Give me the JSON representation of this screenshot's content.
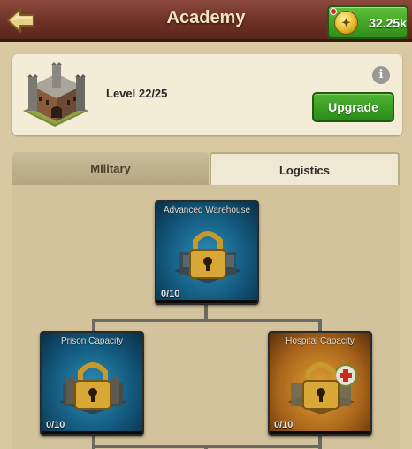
{
  "header": {
    "title": "Academy",
    "gold_amount": "32.25k",
    "back_icon": "back-arrow-icon",
    "currency_icon": "gold-coin-icon"
  },
  "building": {
    "level_text": "Level 22/25",
    "upgrade_label": "Upgrade",
    "info_label": "i"
  },
  "tabs": [
    {
      "label": "Military",
      "active": false
    },
    {
      "label": "Logistics",
      "active": true
    }
  ],
  "tech_nodes": [
    {
      "name": "Advanced Warehouse",
      "progress": "0/10",
      "locked": true,
      "theme": "blue"
    },
    {
      "name": "Prison Capacity",
      "progress": "0/10",
      "locked": true,
      "theme": "blue"
    },
    {
      "name": "Hospital Capacity",
      "progress": "0/10",
      "locked": true,
      "theme": "orange"
    }
  ],
  "colors": {
    "header": "#6e3126",
    "accent_green": "#2f8d19",
    "background": "#d9c9a3"
  }
}
